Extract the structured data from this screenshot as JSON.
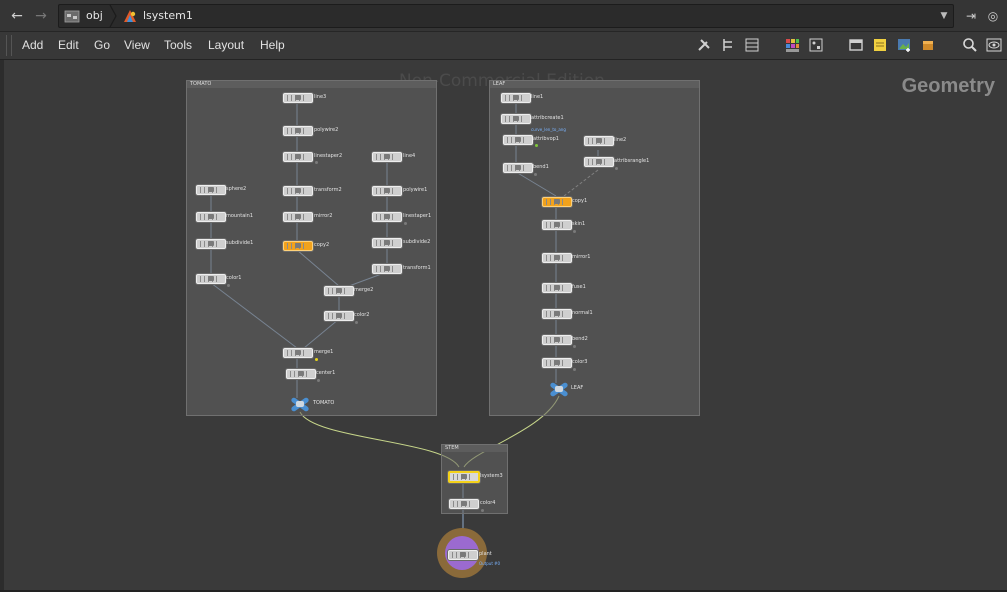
{
  "pathbar": {
    "back_icon": "arrow-left",
    "forward_icon": "arrow-right",
    "crumbs": [
      "obj",
      "lsystem1"
    ]
  },
  "menubar": {
    "items": [
      "Add",
      "Edit",
      "Go",
      "View",
      "Tools",
      "Layout",
      "Help"
    ]
  },
  "network": {
    "watermark": "Non-Commercial Edition",
    "context": "Geometry",
    "boxes": {
      "tomato": "TOMATO",
      "leaf": "LEAF",
      "stem": "STEM"
    },
    "tomato_nodes": {
      "line3": "line3",
      "polywire2": "polywire2",
      "linestaper2": "linestaper2",
      "line4": "line4",
      "transform2": "transform2",
      "polywire1": "polywire1",
      "sphere2": "sphere2",
      "mirror2": "mirror2",
      "mountain1": "mountain1",
      "linestaper1": "linestaper1",
      "subdivide1": "subdivide1",
      "copy2": "copy2",
      "subdivide2": "subdivide2",
      "transform1": "transform1",
      "color1": "color1",
      "merge2": "merge2",
      "color2": "color2",
      "merge1": "merge1",
      "center1": "center1",
      "out": "TOMATO"
    },
    "leaf_nodes": {
      "line1": "line1",
      "attribcreate1": "attribcreate1",
      "attribcreate1_note": "curve_len_to_ang",
      "attribvop1": "attribvop1",
      "line2": "line2",
      "bend1": "bend1",
      "attribsrangle1": "attribsrangle1",
      "copy1": "copy1",
      "skin1": "skin1",
      "mirror1": "mirror1",
      "fuse1": "fuse1",
      "normal1": "normal1",
      "bend2": "bend2",
      "color3": "color3",
      "out": "LEAF"
    },
    "stem_nodes": {
      "lsystem": "lsystem3",
      "color4": "color4"
    },
    "plant_node": "plant",
    "plant_note": "Output #0"
  }
}
